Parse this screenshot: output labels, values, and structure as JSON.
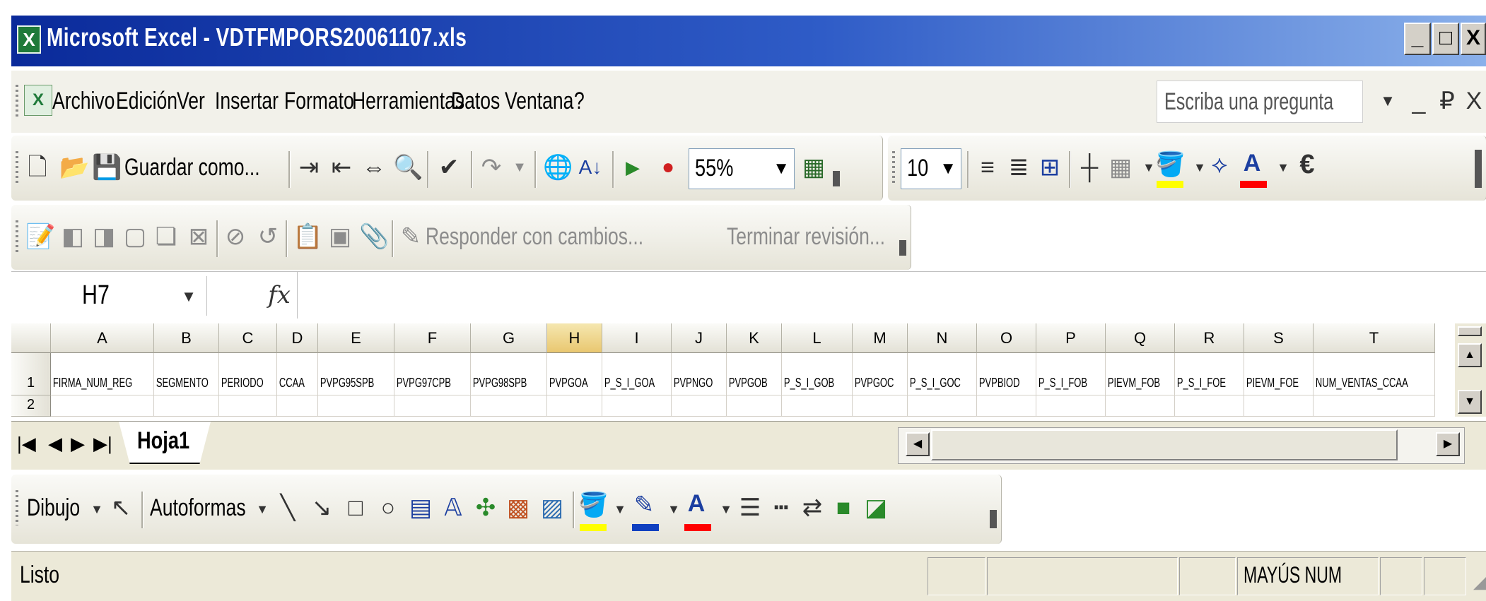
{
  "window": {
    "title": "Microsoft Excel - VDTFMPORS20061107.xls",
    "controls": [
      "_",
      "□",
      "X"
    ]
  },
  "menubar": {
    "items": [
      "Archivo",
      "Edición",
      "Ver",
      "Insertar",
      "Formato",
      "Herramientas",
      "Datos",
      "Ventana",
      "?"
    ],
    "ask_placeholder": "Escriba una pregunta",
    "doc_controls": [
      "_",
      "₽",
      "X"
    ]
  },
  "standard_toolbar": {
    "save_as_label": "Guardar como...",
    "zoom": "55%",
    "font_size": "10",
    "euro_label": "€"
  },
  "review_toolbar": {
    "reply_label": "Responder con cambios...",
    "end_review_label": "Terminar revisión..."
  },
  "formula_bar": {
    "name_box": "H7",
    "fx_label": "fx",
    "formula": ""
  },
  "grid": {
    "columns": [
      "A",
      "B",
      "C",
      "D",
      "E",
      "F",
      "G",
      "H",
      "I",
      "J",
      "K",
      "L",
      "M",
      "N",
      "O",
      "P",
      "Q",
      "R",
      "S",
      "T"
    ],
    "selected_column": "H",
    "rows": [
      {
        "num": "1",
        "cells": [
          "FIRMA_NUM_REG",
          "SEGMENTO",
          "PERIODO",
          "CCAA",
          "PVPG95SPB",
          "PVPG97CPB",
          "PVPG98SPB",
          "PVPGOA",
          "P_S_I_GOA",
          "PVPNGO",
          "PVPGOB",
          "P_S_I_GOB",
          "PVPGOC",
          "P_S_I_GOC",
          "PVPBIOD",
          "P_S_I_FOB",
          "PIEVM_FOB",
          "P_S_I_FOE",
          "PIEVM_FOE",
          "NUM_VENTAS_CCAA"
        ]
      },
      {
        "num": "2",
        "cells": []
      }
    ]
  },
  "sheet_tabs": {
    "active": "Hoja1"
  },
  "drawing_toolbar": {
    "draw_label": "Dibujo",
    "autoshapes_label": "Autoformas"
  },
  "statusbar": {
    "status": "Listo",
    "indicators": "MAYÚS NUM"
  },
  "colors": {
    "title_start": "#0a2a9a",
    "title_end": "#8ab0ea",
    "fill_color": "#ffff00",
    "font_color": "#ff0000",
    "line_color": "#1040c0",
    "selected_header": "#e9c770"
  }
}
